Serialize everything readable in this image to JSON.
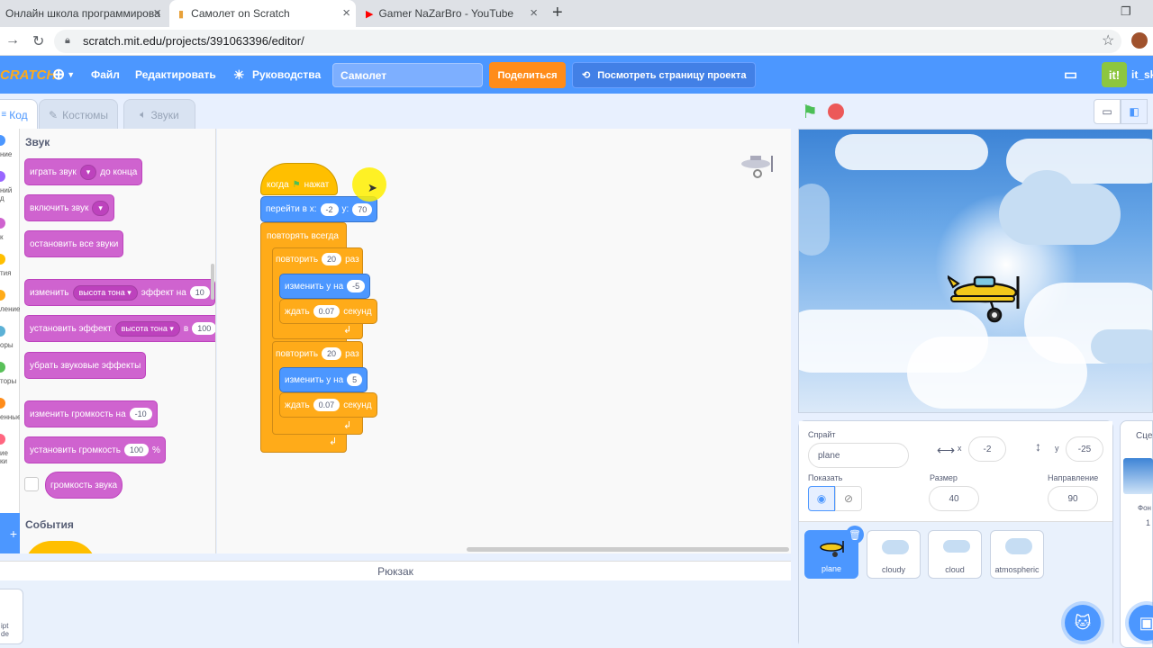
{
  "browser": {
    "tabs": [
      {
        "title": "Онлайн школа программирова",
        "active": false
      },
      {
        "title": "Самолет on Scratch",
        "active": true
      },
      {
        "title": "Gamer NaZarBro - YouTube",
        "active": false
      }
    ],
    "new_tab": "+",
    "url": "scratch.mit.edu/projects/391063396/editor/"
  },
  "menu": {
    "logo": "SCRATCH",
    "file": "Файл",
    "edit": "Редактировать",
    "tutorials": "Руководства",
    "project_title": "Самолет",
    "share": "Поделиться",
    "see_project": "Посмотреть страницу проекта",
    "username": "it_sk",
    "avatar_text": "it!"
  },
  "editor_tabs": {
    "code": "Код",
    "costumes": "Костюмы",
    "sounds": "Звуки"
  },
  "categories": [
    {
      "label": "ние",
      "color": "#4c97ff"
    },
    {
      "label": "ний\nд",
      "color": "#9966ff"
    },
    {
      "label": "к",
      "color": "#cf63cf"
    },
    {
      "label": "тия",
      "color": "#ffbf00"
    },
    {
      "label": "ление",
      "color": "#ffab19"
    },
    {
      "label": "оры",
      "color": "#5cb1d6"
    },
    {
      "label": "торы",
      "color": "#59c059"
    },
    {
      "label": "енные",
      "color": "#ff8c1a"
    },
    {
      "label": "ие\nки",
      "color": "#ff6680"
    }
  ],
  "palette": {
    "section_sound": "Звук",
    "play_sound": "играть звук",
    "until_done": "до конца",
    "start_sound": "включить звук",
    "stop_all_sounds": "остановить все звуки",
    "change_effect": "изменить",
    "pitch": "высота тона",
    "effect_by": "эффект на",
    "effect_by_value": "10",
    "set_effect": "установить эффект",
    "set_effect_to": "в",
    "set_effect_value": "100",
    "clear_effects": "убрать звуковые эффекты",
    "change_volume": "изменить громкость на",
    "change_volume_value": "-10",
    "set_volume": "установить громкость",
    "set_volume_value": "100",
    "percent": "%",
    "volume": "громкость звука",
    "section_events": "События"
  },
  "script": {
    "when_flag": "когда",
    "clicked": "нажат",
    "goto": "перейти в x:",
    "goto_x": "-2",
    "goto_y_label": "y:",
    "goto_y": "70",
    "forever": "повторять всегда",
    "repeat1": "повторить",
    "repeat1_n": "20",
    "times": "раз",
    "change_y1": "изменить у на",
    "change_y1_val": "-5",
    "wait1": "ждать",
    "wait1_val": "0.07",
    "seconds": "секунд",
    "repeat2": "повторить",
    "repeat2_n": "20",
    "change_y2": "изменить у на",
    "change_y2_val": "5",
    "wait2": "ждать",
    "wait2_val": "0.07"
  },
  "backpack": "Рюкзак",
  "backpack_item": "ipt\nde",
  "sprite": {
    "label": "Спрайт",
    "name": "plane",
    "x_label": "x",
    "x": "-2",
    "y_label": "y",
    "y": "-25",
    "show_label": "Показать",
    "size_label": "Размер",
    "size": "40",
    "direction_label": "Направление",
    "direction": "90"
  },
  "sprites": [
    "plane",
    "cloudy",
    "cloud",
    "atmospheric"
  ],
  "stage_panel": {
    "label": "Сце",
    "backdrops_label": "Фон",
    "backdrops_count": "1"
  }
}
